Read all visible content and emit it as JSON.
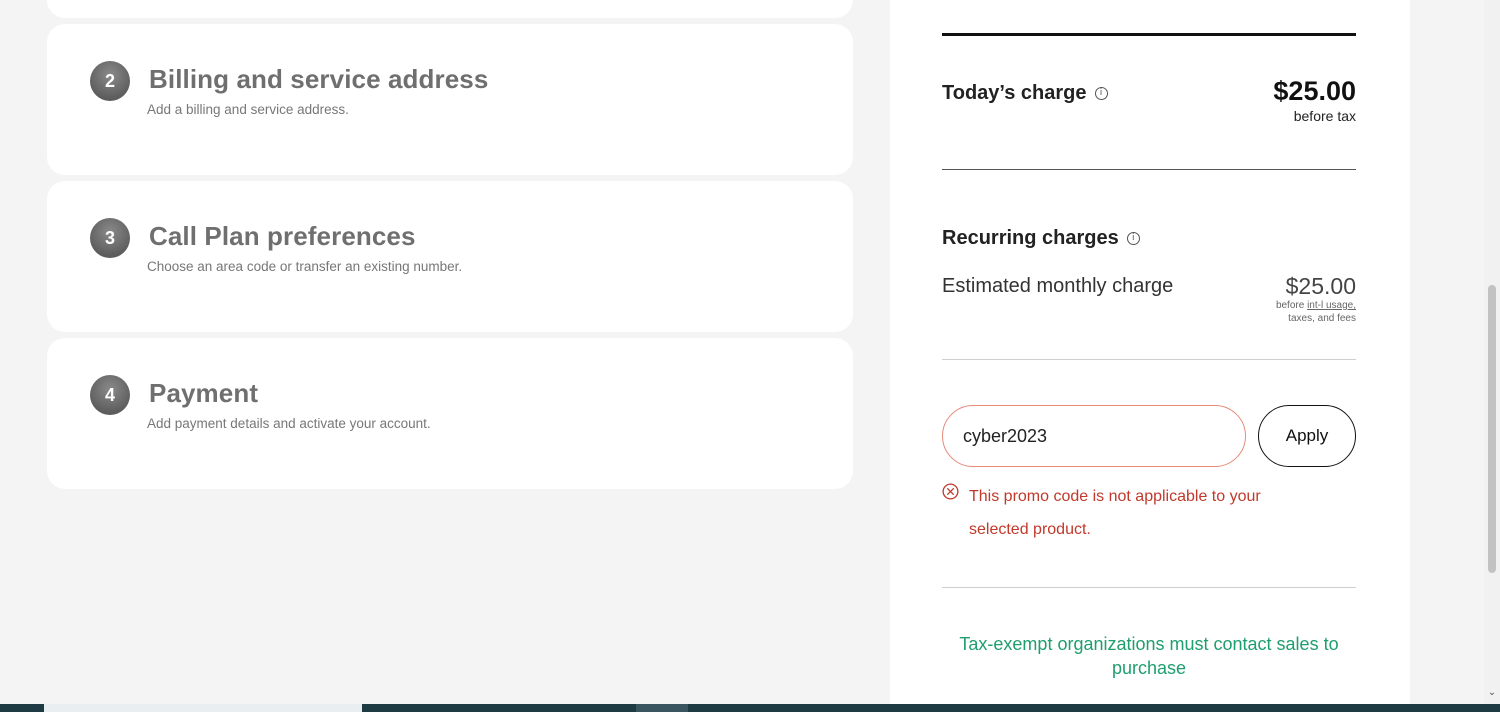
{
  "steps": [
    {
      "number": "2",
      "title": "Billing and service address",
      "subtitle": "Add a billing and service address."
    },
    {
      "number": "3",
      "title": "Call Plan preferences",
      "subtitle": "Choose an area code or transfer an existing number."
    },
    {
      "number": "4",
      "title": "Payment",
      "subtitle": "Add payment details and activate your account."
    }
  ],
  "summary": {
    "today_label": "Today’s charge",
    "today_amount": "$25.00",
    "today_note": "before tax",
    "recurring_label": "Recurring charges",
    "monthly_label": "Estimated monthly charge",
    "monthly_amount": "$25.00",
    "monthly_note_prefix": "before ",
    "monthly_note_link": "int-l usage,",
    "monthly_note_suffix": "taxes, and fees"
  },
  "promo": {
    "value": "cyber2023",
    "apply_label": "Apply",
    "error": "This promo code is not applicable to your selected product."
  },
  "tax_note": "Tax-exempt organizations must contact sales to purchase",
  "colors": {
    "error": "#c0392b",
    "input_error_border": "#e68a7a",
    "tax_note": "#1f9e6e"
  },
  "icons": {
    "info": "info-circle-icon",
    "error": "x-circle-icon"
  }
}
